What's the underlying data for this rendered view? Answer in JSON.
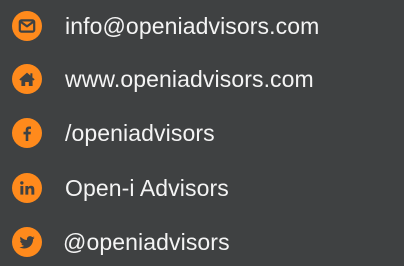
{
  "contacts": [
    {
      "icon": "email-icon",
      "text": "info@openiadvisors.com"
    },
    {
      "icon": "home-icon",
      "text": "www.openiadvisors.com"
    },
    {
      "icon": "facebook-icon",
      "text": "/openiadvisors"
    },
    {
      "icon": "linkedin-icon",
      "text": "Open-i Advisors"
    },
    {
      "icon": "twitter-icon",
      "text": "@openiadvisors"
    }
  ],
  "colors": {
    "background": "#3f4142",
    "icon_accent": "#ff8a1c",
    "text": "#f4f4f4"
  }
}
